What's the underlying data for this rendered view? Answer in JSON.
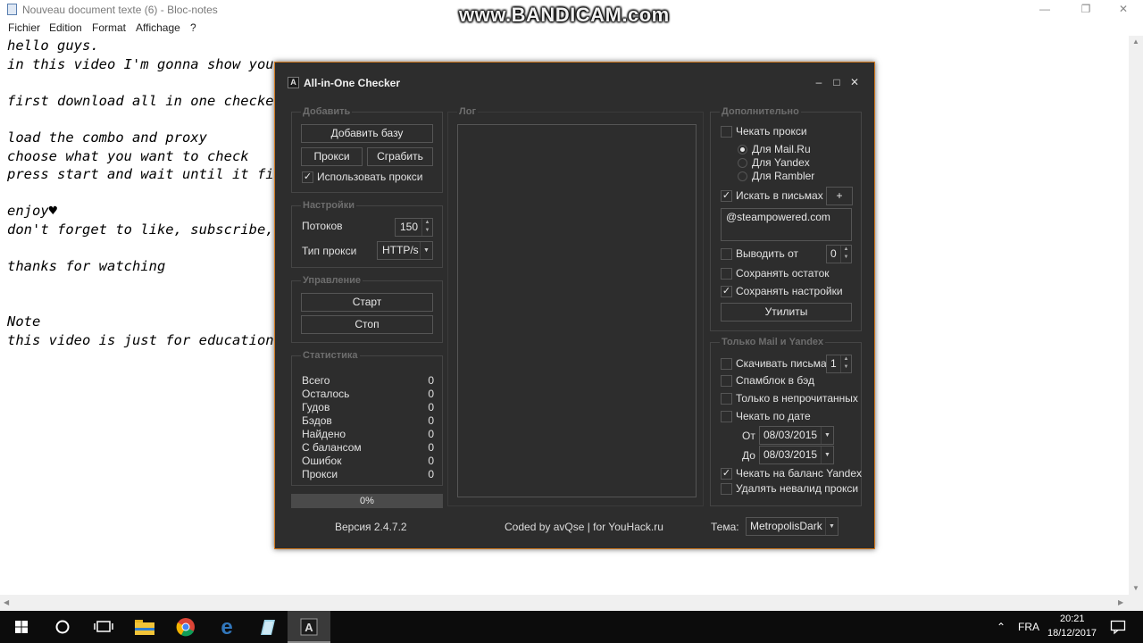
{
  "notepad": {
    "title": "Nouveau document texte (6) - Bloc-notes",
    "menu": [
      "Fichier",
      "Edition",
      "Format",
      "Affichage",
      "?"
    ],
    "lines": [
      "hello guys.",
      "in this video I'm gonna show you",
      "",
      "first download all in one checke",
      "",
      "load the combo and proxy",
      "choose what you want to check",
      "press start and wait until it fi",
      "",
      "enjoy♥",
      "don't forget to like, subscribe,",
      "",
      "thanks for watching",
      "",
      "",
      "Note",
      "this video is just for education"
    ]
  },
  "watermark": "www.BANDICAM.com",
  "checker": {
    "title": "All-in-One Checker",
    "add_group": {
      "title": "Добавить",
      "add_base": "Добавить базу",
      "proxy": "Прокси",
      "grab": "Сграбить",
      "use_proxy": "Использовать прокси",
      "use_proxy_checked": true
    },
    "settings_group": {
      "title": "Настройки",
      "threads_label": "Потоков",
      "threads_value": "150",
      "proxy_type_label": "Тип прокси",
      "proxy_type_value": "HTTP/s"
    },
    "control_group": {
      "title": "Управление",
      "start": "Старт",
      "stop": "Стоп"
    },
    "stats_group": {
      "title": "Статистика",
      "rows": [
        {
          "label": "Всего",
          "value": "0"
        },
        {
          "label": "Осталось",
          "value": "0"
        },
        {
          "label": "Гудов",
          "value": "0"
        },
        {
          "label": "Бэдов",
          "value": "0"
        },
        {
          "label": "Найдено",
          "value": "0"
        },
        {
          "label": "С балансом",
          "value": "0"
        },
        {
          "label": "Ошибок",
          "value": "0"
        },
        {
          "label": "Прокси",
          "value": "0"
        }
      ]
    },
    "progress": {
      "label": "0%",
      "fraction": 0
    },
    "log_group": {
      "title": "Лог"
    },
    "extra_group": {
      "title": "Дополнительно",
      "check_proxy": "Чекать прокси",
      "radios": [
        "Для Mail.Ru",
        "Для Yandex",
        "Для Rambler"
      ],
      "radio_selected": 0,
      "search_in_mail": "Искать в письмах",
      "add_btn": "+",
      "search_value": "@steampowered.com",
      "output_from": "Выводить от",
      "output_from_value": "0",
      "save_rest": "Сохранять остаток",
      "save_settings": "Сохранять настройки",
      "utilities": "Утилиты"
    },
    "mail_group": {
      "title": "Только Mail и Yandex",
      "download_letters": "Скачивать письма",
      "download_value": "1",
      "spamblock": "Спамблок в бэд",
      "only_unread": "Только в непрочитанных",
      "check_by_date": "Чекать по дате",
      "from_label": "От",
      "from_date": "08/03/2015",
      "to_label": "До",
      "to_date": "08/03/2015",
      "check_balance": "Чекать на баланс Yandex",
      "remove_invalid": "Удалять невалид прокси"
    },
    "footer": {
      "version": "Версия 2.4.7.2",
      "credits": "Coded by avQse | for YouHack.ru",
      "theme_label": "Тема:",
      "theme_value": "MetropolisDark"
    }
  },
  "taskbar": {
    "lang": "FRA",
    "time": "20:21",
    "date": "18/12/2017"
  }
}
